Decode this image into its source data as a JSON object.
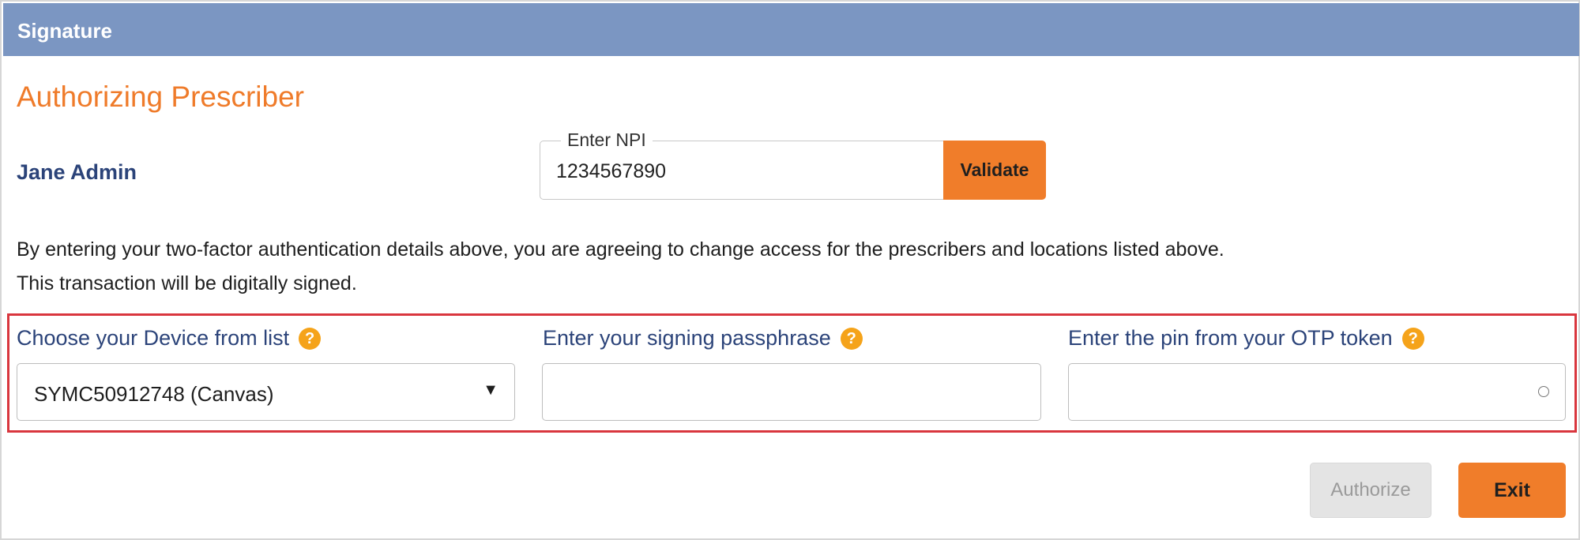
{
  "header": {
    "title": "Signature"
  },
  "section": {
    "title": "Authorizing Prescriber"
  },
  "prescriber": {
    "name": "Jane Admin"
  },
  "npi": {
    "label": "Enter NPI",
    "value": "1234567890",
    "validate_label": "Validate"
  },
  "consent": {
    "line1": "By entering your two-factor authentication details above, you are agreeing to change access for the prescribers and locations listed above.",
    "line2": "This transaction will be digitally signed."
  },
  "fields": {
    "device": {
      "label": "Choose your Device from list",
      "selected": "SYMC50912748 (Canvas)"
    },
    "passphrase": {
      "label": "Enter your signing passphrase",
      "value": ""
    },
    "otp": {
      "label": "Enter the pin from your OTP token",
      "value": ""
    },
    "help_glyph": "?"
  },
  "actions": {
    "authorize_label": "Authorize",
    "exit_label": "Exit"
  },
  "colors": {
    "header_bg": "#7b96c2",
    "accent_orange": "#f07d2a",
    "label_navy": "#2b4379",
    "help_icon": "#f5a31a",
    "highlight_border": "#d9363e",
    "disabled_button": "#e4e4e4"
  }
}
